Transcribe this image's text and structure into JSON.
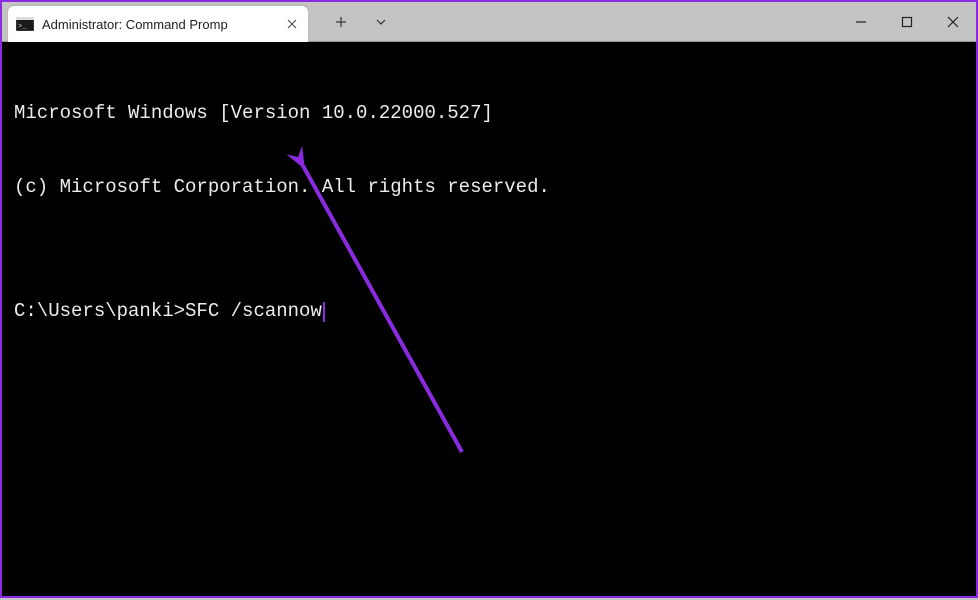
{
  "window": {
    "tab_title": "Administrator: Command Promp",
    "tab_icon": "cmd-icon",
    "new_tab_label": "+",
    "dropdown_label": "v"
  },
  "controls": {
    "minimize": "minimize",
    "maximize": "maximize",
    "close": "close"
  },
  "terminal": {
    "lines": [
      "Microsoft Windows [Version 10.0.22000.527]",
      "(c) Microsoft Corporation. All rights reserved.",
      "",
      "C:\\Users\\panki>SFC /scannow"
    ],
    "prompt": "C:\\Users\\panki>",
    "command": "SFC /scannow"
  },
  "annotation": {
    "color": "#8a2be2",
    "type": "arrow"
  }
}
